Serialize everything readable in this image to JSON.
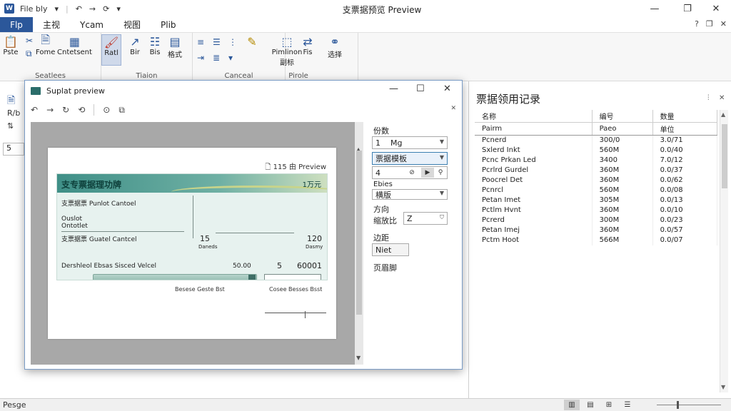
{
  "window": {
    "title": "支票据预览 Preview",
    "quick_access": "File bly",
    "minimize": "—",
    "maximize": "❐",
    "close": "✕"
  },
  "menu": {
    "file": "Flp",
    "tabs": [
      "主视",
      "Ycam",
      "视图",
      "Plib"
    ]
  },
  "ribbon": {
    "groups": [
      "Seatlees",
      "Tiaion",
      "Canceal",
      "Pirole"
    ],
    "buttons": {
      "paste": "Pste",
      "fome": "Fome",
      "cntetsent": "Cntetsent",
      "font_active": "Ratl",
      "bir": "Bir",
      "bis": "Bis",
      "align": "格式",
      "pimlinon": "Pimlinon",
      "pimlinon_sub": "副标",
      "fis": "Fis",
      "select": "选择"
    }
  },
  "left": {
    "rb": "R/b",
    "input_value": "5"
  },
  "dialog": {
    "title": "Suplat preview",
    "preview": {
      "header": "115 由 Preview",
      "ticket_title": "支专票据理功牌",
      "ticket_title_right": "1万元",
      "control_line1": "支票据票 Punlot Cantoel",
      "label_a": "Ouslot",
      "label_b": "Ontotlet",
      "control_line2": "支票据票 Guatel Cantcel",
      "mid_value": "15",
      "mid_note": "Daneds",
      "right_value": "120",
      "right_note": "Dasmy",
      "bottom_label": "Dershleol  Ebsas  Sisced  Velcel",
      "bottom_num": "50.00",
      "bottom_count": "5",
      "bottom_amount": "60001",
      "foot_left": "Besese Geste Bst",
      "foot_right": "Cosee  Besses  Bsst"
    },
    "settings": {
      "copies_label": "份数",
      "copies_value": "1",
      "copies_unit": "Mg",
      "printer_value": "票据模板",
      "pages_value": "4",
      "paper_label": "Ebies",
      "paper_value": "横版",
      "orient_label": "方向",
      "scale_label": "缩放比",
      "scale_value": "Z",
      "margin_label": "边距",
      "margin_value": "Niet",
      "footer_label": "页眉脚"
    }
  },
  "records": {
    "title": "票据领用记录",
    "columns": [
      "名称",
      "编号",
      "数量"
    ],
    "subheader": [
      "Pairm",
      "Paeo",
      "单位"
    ],
    "rows": [
      [
        "Pcnerd",
        "300/0",
        "3.0/71"
      ],
      [
        "Sxlerd Inkt",
        "560M",
        "0.0/40"
      ],
      [
        "Pcnc Prkan Led",
        "3400",
        "7.0/12"
      ],
      [
        "Pcrlrd Gurdel",
        "360M",
        "0.0/37"
      ],
      [
        "Poocrel Det",
        "360M",
        "0.0/62"
      ],
      [
        "Pcnrcl",
        "560M",
        "0.0/08"
      ],
      [
        "Petan Imet",
        "305M",
        "0.0/13"
      ],
      [
        "Pctlm Hvnt",
        "360M",
        "0.0/10"
      ],
      [
        "Pcrerd",
        "300M",
        "0.0/23"
      ],
      [
        "Petan Imej",
        "360M",
        "0.0/57"
      ],
      [
        "Pctm Hoot",
        "566M",
        "0.0/07"
      ]
    ]
  },
  "status": {
    "left": "Pesge"
  }
}
